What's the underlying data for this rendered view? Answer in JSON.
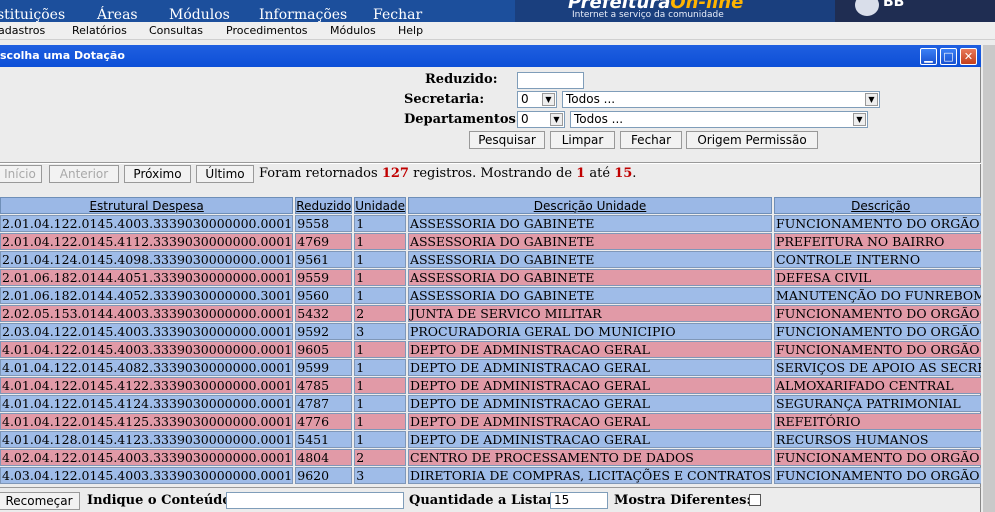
{
  "top_nav": [
    "stituições",
    "Áreas",
    "Módulos",
    "Informações",
    "Fechar"
  ],
  "brand": {
    "title_part1": "Prefeitura",
    "title_part2": "On-line",
    "tagline": "Internet a serviço da comunidade",
    "partner": "BB"
  },
  "menu": [
    "adastros",
    "Relatórios",
    "Consultas",
    "Procedimentos",
    "Módulos",
    "Help"
  ],
  "dialog": {
    "title": "scolha uma Dotação",
    "minimize_icon": "minimize-icon",
    "maximize_icon": "maximize-icon",
    "close_icon": "close-icon"
  },
  "filters": {
    "reduzido_label": "Reduzido:",
    "reduzido_value": "",
    "secretaria_label": "Secretaria:",
    "secretaria_code": "0",
    "secretaria_name": "Todos ...",
    "departamentos_label": "Departamentos:",
    "departamentos_code": "0",
    "departamentos_name": "Todos ..."
  },
  "actions": {
    "pesquisar": "Pesquisar",
    "limpar": "Limpar",
    "fechar": "Fechar",
    "origem": "Origem Permissão"
  },
  "pager": {
    "inicio": "Início",
    "anterior": "Anterior",
    "proximo": "Próximo",
    "ultimo": "Último"
  },
  "info": {
    "prefix": "Foram retornados",
    "total": "127",
    "mid": "registros. Mostrando de",
    "from": "1",
    "ate": "até",
    "to": "15",
    "dot": "."
  },
  "columns": [
    "Estrutural Despesa",
    "Reduzido",
    "Unidade",
    "Descrição Unidade",
    "Descrição"
  ],
  "rows": [
    {
      "estrutural": "2.01.04.122.0145.4003.3339030000000.0001",
      "reduzido": "9558",
      "unidade": "1",
      "desc_unidade": "ASSESSORIA DO GABINETE",
      "descricao": "FUNCIONAMENTO DO ORGÃO",
      "color": "blue"
    },
    {
      "estrutural": "2.01.04.122.0145.4112.3339030000000.0001",
      "reduzido": "4769",
      "unidade": "1",
      "desc_unidade": "ASSESSORIA DO GABINETE",
      "descricao": "PREFEITURA NO BAIRRO",
      "color": "pink"
    },
    {
      "estrutural": "2.01.04.124.0145.4098.3339030000000.0001",
      "reduzido": "9561",
      "unidade": "1",
      "desc_unidade": "ASSESSORIA DO GABINETE",
      "descricao": "CONTROLE INTERNO",
      "color": "blue"
    },
    {
      "estrutural": "2.01.06.182.0144.4051.3339030000000.0001",
      "reduzido": "9559",
      "unidade": "1",
      "desc_unidade": "ASSESSORIA DO GABINETE",
      "descricao": "DEFESA CIVIL",
      "color": "pink"
    },
    {
      "estrutural": "2.01.06.182.0144.4052.3339030000000.3001",
      "reduzido": "9560",
      "unidade": "1",
      "desc_unidade": "ASSESSORIA DO GABINETE",
      "descricao": "MANUTENÇÃO DO FUNREBOM",
      "color": "blue"
    },
    {
      "estrutural": "2.02.05.153.0144.4003.3339030000000.0001",
      "reduzido": "5432",
      "unidade": "2",
      "desc_unidade": "JUNTA DE SERVICO MILITAR",
      "descricao": "FUNCIONAMENTO DO ORGÃO",
      "color": "pink"
    },
    {
      "estrutural": "2.03.04.122.0145.4003.3339030000000.0001",
      "reduzido": "9592",
      "unidade": "3",
      "desc_unidade": "PROCURADORIA GERAL DO MUNICIPIO",
      "descricao": "FUNCIONAMENTO DO ORGÃO",
      "color": "blue"
    },
    {
      "estrutural": "4.01.04.122.0145.4003.3339030000000.0001",
      "reduzido": "9605",
      "unidade": "1",
      "desc_unidade": "DEPTO DE ADMINISTRACAO GERAL",
      "descricao": "FUNCIONAMENTO DO ORGÃO",
      "color": "pink"
    },
    {
      "estrutural": "4.01.04.122.0145.4082.3339030000000.0001",
      "reduzido": "9599",
      "unidade": "1",
      "desc_unidade": "DEPTO DE ADMINISTRACAO GERAL",
      "descricao": "SERVIÇOS DE APOIO AS SECRE",
      "color": "blue"
    },
    {
      "estrutural": "4.01.04.122.0145.4122.3339030000000.0001",
      "reduzido": "4785",
      "unidade": "1",
      "desc_unidade": "DEPTO DE ADMINISTRACAO GERAL",
      "descricao": "ALMOXARIFADO CENTRAL",
      "color": "pink"
    },
    {
      "estrutural": "4.01.04.122.0145.4124.3339030000000.0001",
      "reduzido": "4787",
      "unidade": "1",
      "desc_unidade": "DEPTO DE ADMINISTRACAO GERAL",
      "descricao": "SEGURANÇA PATRIMONIAL",
      "color": "blue"
    },
    {
      "estrutural": "4.01.04.122.0145.4125.3339030000000.0001",
      "reduzido": "4776",
      "unidade": "1",
      "desc_unidade": "DEPTO DE ADMINISTRACAO GERAL",
      "descricao": "REFEITÓRIO",
      "color": "pink"
    },
    {
      "estrutural": "4.01.04.128.0145.4123.3339030000000.0001",
      "reduzido": "5451",
      "unidade": "1",
      "desc_unidade": "DEPTO DE ADMINISTRACAO GERAL",
      "descricao": "RECURSOS HUMANOS",
      "color": "blue"
    },
    {
      "estrutural": "4.02.04.122.0145.4003.3339030000000.0001",
      "reduzido": "4804",
      "unidade": "2",
      "desc_unidade": "CENTRO DE PROCESSAMENTO DE DADOS",
      "descricao": "FUNCIONAMENTO DO ORGÃO",
      "color": "pink"
    },
    {
      "estrutural": "4.03.04.122.0145.4003.3339030000000.0001",
      "reduzido": "9620",
      "unidade": "3",
      "desc_unidade": "DIRETORIA DE COMPRAS, LICITAÇÕES E CONTRATOS",
      "descricao": "FUNCIONAMENTO DO ORGÃO",
      "color": "blue"
    }
  ],
  "bottom": {
    "recomecar": "Recomeçar",
    "indique_label": "Indique o Conteúdo:",
    "indique_value": "",
    "quantidade_label": "Quantidade a Listar:",
    "quantidade_value": "15",
    "mostra_label": "Mostra Diferentes:",
    "mostra_checked": false
  },
  "colors": {
    "row_blue": "#9fbce8",
    "row_pink": "#e19aa7",
    "header": "#9bb8e6",
    "titlebar": "#1f5fe0",
    "highlight_red": "#c00000"
  }
}
